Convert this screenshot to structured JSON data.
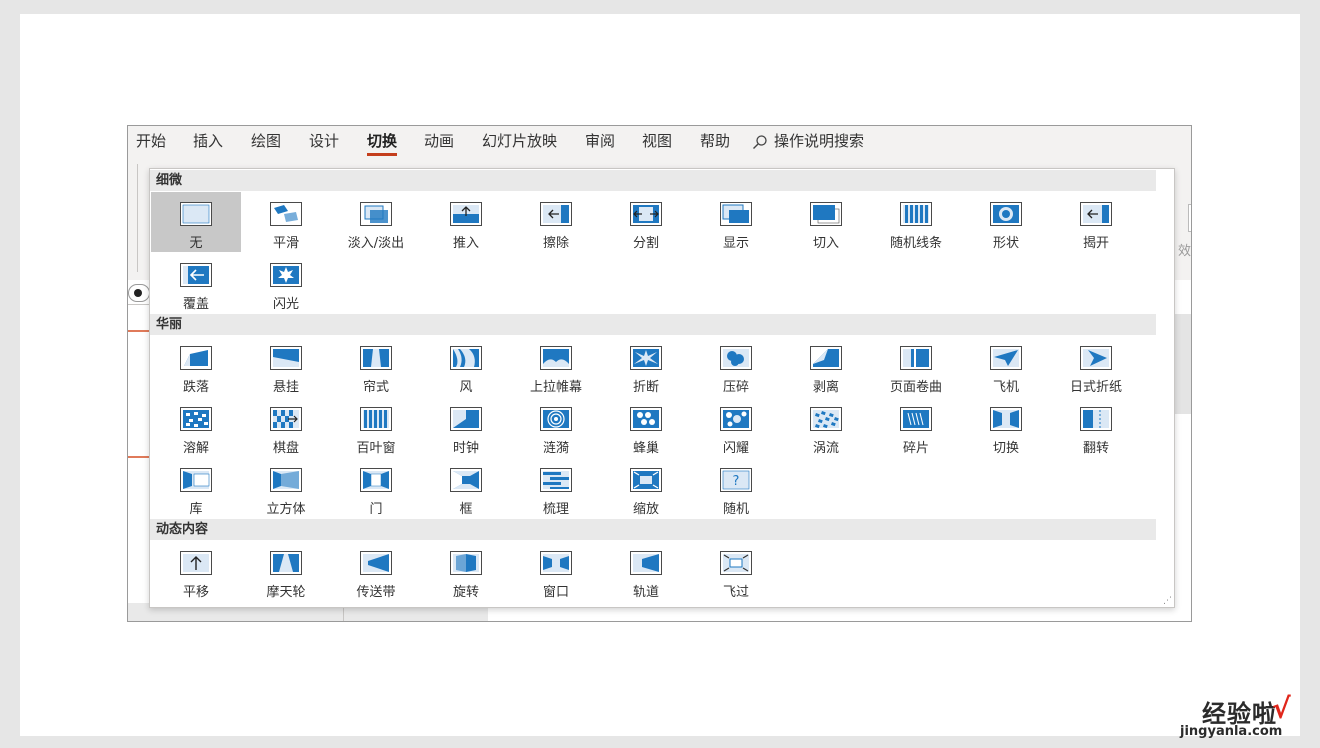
{
  "menu": {
    "tabs": [
      {
        "label": "开始"
      },
      {
        "label": "插入"
      },
      {
        "label": "绘图"
      },
      {
        "label": "设计"
      },
      {
        "label": "切换"
      },
      {
        "label": "动画"
      },
      {
        "label": "幻灯片放映"
      },
      {
        "label": "审阅"
      },
      {
        "label": "视图"
      },
      {
        "label": "帮助"
      }
    ],
    "active_tab": "切换",
    "search_label": "操作说明搜索"
  },
  "ribbon": {
    "effect_options_label": "效"
  },
  "gallery": {
    "sections": [
      {
        "title": "细微",
        "items": [
          {
            "label": "无",
            "icon": "none-transition-icon",
            "selected": true
          },
          {
            "label": "平滑",
            "icon": "morph-transition-icon"
          },
          {
            "label": "淡入/淡出",
            "icon": "fade-transition-icon"
          },
          {
            "label": "推入",
            "icon": "push-transition-icon"
          },
          {
            "label": "擦除",
            "icon": "wipe-transition-icon"
          },
          {
            "label": "分割",
            "icon": "split-transition-icon"
          },
          {
            "label": "显示",
            "icon": "reveal-transition-icon"
          },
          {
            "label": "切入",
            "icon": "cut-transition-icon"
          },
          {
            "label": "随机线条",
            "icon": "random-bars-transition-icon"
          },
          {
            "label": "形状",
            "icon": "shape-transition-icon"
          },
          {
            "label": "揭开",
            "icon": "uncover-transition-icon"
          },
          {
            "label": "覆盖",
            "icon": "cover-transition-icon"
          },
          {
            "label": "闪光",
            "icon": "flash-transition-icon"
          }
        ]
      },
      {
        "title": "华丽",
        "items": [
          {
            "label": "跌落",
            "icon": "fall-over-transition-icon"
          },
          {
            "label": "悬挂",
            "icon": "drape-transition-icon"
          },
          {
            "label": "帘式",
            "icon": "curtains-transition-icon"
          },
          {
            "label": "风",
            "icon": "wind-transition-icon"
          },
          {
            "label": "上拉帷幕",
            "icon": "prestige-transition-icon"
          },
          {
            "label": "折断",
            "icon": "fracture-transition-icon"
          },
          {
            "label": "压碎",
            "icon": "crush-transition-icon"
          },
          {
            "label": "剥离",
            "icon": "peel-off-transition-icon"
          },
          {
            "label": "页面卷曲",
            "icon": "page-curl-transition-icon"
          },
          {
            "label": "飞机",
            "icon": "airplane-transition-icon"
          },
          {
            "label": "日式折纸",
            "icon": "origami-transition-icon"
          },
          {
            "label": "溶解",
            "icon": "dissolve-transition-icon"
          },
          {
            "label": "棋盘",
            "icon": "checkerboard-transition-icon"
          },
          {
            "label": "百叶窗",
            "icon": "blinds-transition-icon"
          },
          {
            "label": "时钟",
            "icon": "clock-transition-icon"
          },
          {
            "label": "涟漪",
            "icon": "ripple-transition-icon"
          },
          {
            "label": "蜂巢",
            "icon": "honeycomb-transition-icon"
          },
          {
            "label": "闪耀",
            "icon": "glitter-transition-icon"
          },
          {
            "label": "涡流",
            "icon": "vortex-transition-icon"
          },
          {
            "label": "碎片",
            "icon": "shred-transition-icon"
          },
          {
            "label": "切换",
            "icon": "switch-transition-icon"
          },
          {
            "label": "翻转",
            "icon": "flip-transition-icon"
          },
          {
            "label": "库",
            "icon": "gallery-transition-icon"
          },
          {
            "label": "立方体",
            "icon": "cube-transition-icon"
          },
          {
            "label": "门",
            "icon": "doors-transition-icon"
          },
          {
            "label": "框",
            "icon": "box-transition-icon"
          },
          {
            "label": "梳理",
            "icon": "comb-transition-icon"
          },
          {
            "label": "缩放",
            "icon": "zoom-transition-icon"
          },
          {
            "label": "随机",
            "icon": "random-transition-icon"
          }
        ]
      },
      {
        "title": "动态内容",
        "items": [
          {
            "label": "平移",
            "icon": "pan-transition-icon"
          },
          {
            "label": "摩天轮",
            "icon": "ferris-wheel-transition-icon"
          },
          {
            "label": "传送带",
            "icon": "conveyor-transition-icon"
          },
          {
            "label": "旋转",
            "icon": "rotate-transition-icon"
          },
          {
            "label": "窗口",
            "icon": "window-transition-icon"
          },
          {
            "label": "轨道",
            "icon": "orbit-transition-icon"
          },
          {
            "label": "飞过",
            "icon": "fly-through-transition-icon"
          }
        ]
      }
    ]
  },
  "watermark": {
    "brand": "经验啦",
    "check": "√",
    "url": "jingyanla.com"
  },
  "colors": {
    "accent": "#1f78c1",
    "light": "#dbe8f5",
    "active_underline": "#c43e1c",
    "selected_tile": "#c8c8c8"
  }
}
